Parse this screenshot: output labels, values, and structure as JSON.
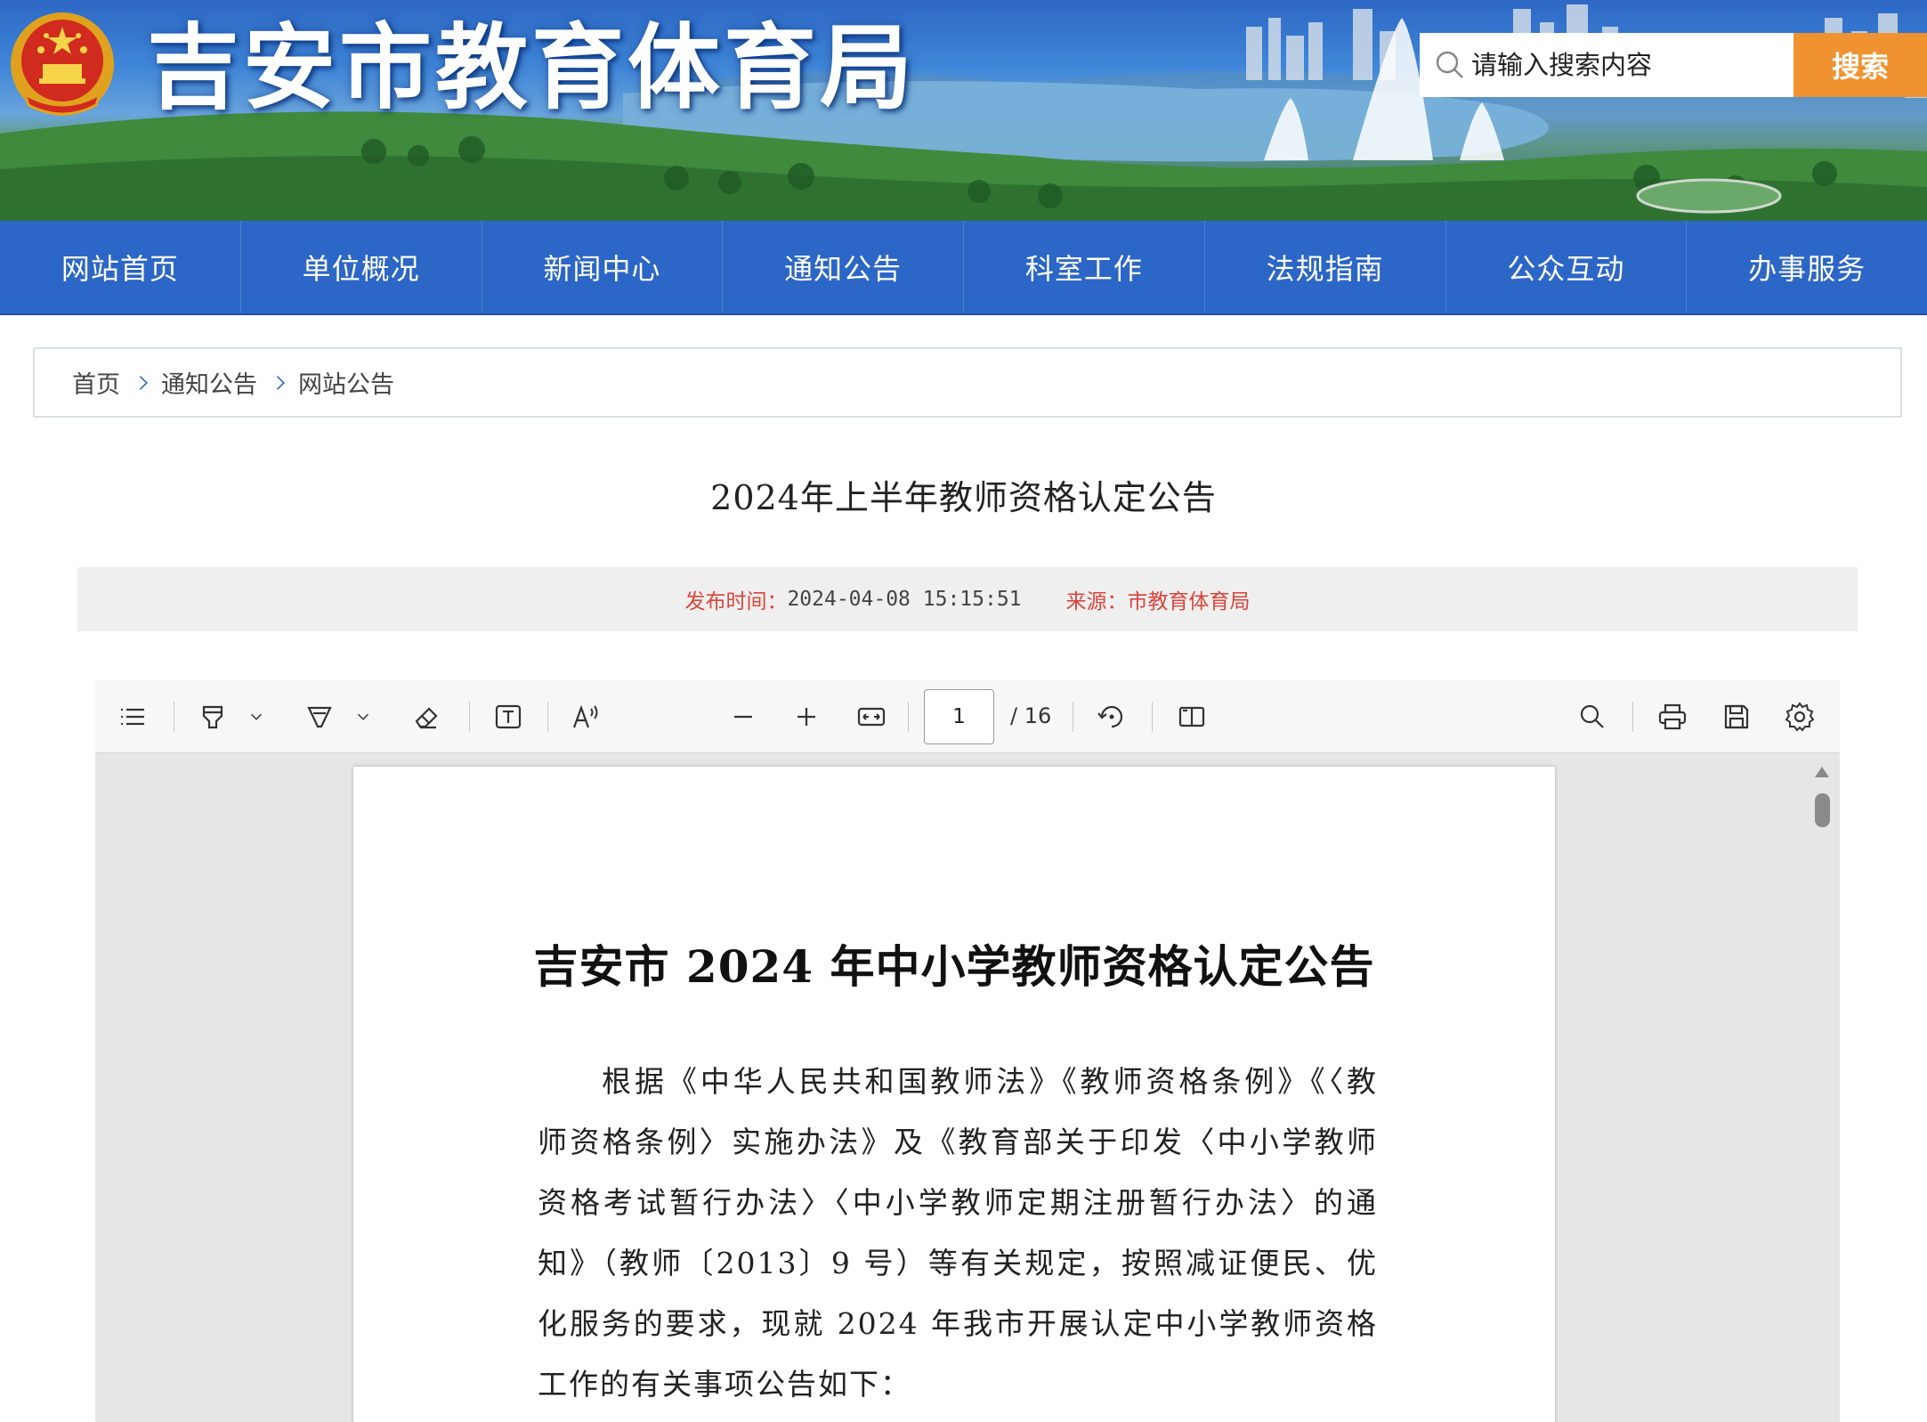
{
  "site": {
    "title": "吉安市教育体育局",
    "search_placeholder": "请输入搜索内容",
    "search_button": "搜索"
  },
  "nav": {
    "items": [
      "网站首页",
      "单位概况",
      "新闻中心",
      "通知公告",
      "科室工作",
      "法规指南",
      "公众互动",
      "办事服务"
    ]
  },
  "breadcrumb": [
    "首页",
    "通知公告",
    "网站公告"
  ],
  "article": {
    "title": "2024年上半年教师资格认定公告",
    "publish_label": "发布时间：",
    "publish_value": "2024-04-08 15:15:51",
    "source_label": "来源：",
    "source_value": "市教育体育局"
  },
  "viewer": {
    "current_page": "1",
    "total_pages": "/ 16",
    "toolbar_icons": [
      "contents-icon",
      "highlight-icon",
      "draw-icon",
      "eraser-icon",
      "text-box-icon",
      "read-aloud-icon",
      "zoom-out-icon",
      "zoom-in-icon",
      "fit-width-icon",
      "rotate-icon",
      "page-view-icon",
      "search-icon",
      "print-icon",
      "save-icon",
      "settings-icon"
    ]
  },
  "document": {
    "title": "吉安市 2024 年中小学教师资格认定公告",
    "lines": [
      "根据《中华人民共和国教师法》《教师资格条例》《〈教",
      "师资格条例〉实施办法》及《教育部关于印发〈中小学教师",
      "资格考试暂行办法〉〈中小学教师定期注册暂行办法〉的通",
      "知》（教师〔2013〕9 号）等有关规定，按照减证便民、优",
      "化服务的要求，现就 2024 年我市开展认定中小学教师资格",
      "工作的有关事项公告如下："
    ]
  },
  "colors": {
    "nav_bg": "#2c66c6",
    "search_button_bg": "#f0922f",
    "meta_label": "#d9453a"
  }
}
